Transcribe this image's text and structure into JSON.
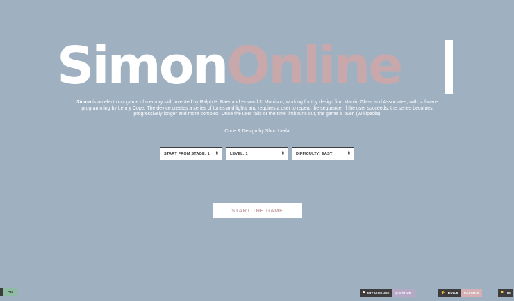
{
  "logo": {
    "word1": "Simon",
    "word2": "Online"
  },
  "description": {
    "lead": "Simon",
    "body": " is an electronic game of memory skill invented by Ralph H. Baer and Howard J. Morrison, working for toy design firm Marvin Glass and Associates, with software programming by Lenny Cope. The device creates a series of tones and lights and requires a user to repeat the sequence. If the user succeeds, the series becomes progressively longer and more complex. Once the user fails or the time limit runs out, the game is over. (Wikipedia)"
  },
  "credit": "Code & Design by Shun Ueda",
  "selects": {
    "stage": "START FROM STAGE: 1",
    "level": "LEVEL: 1",
    "difficulty": "DIFFICULTY: EASY"
  },
  "start_button": "START THE GAME",
  "badges": {
    "left_toggle": "ON",
    "license_label": "MIT LICENSE",
    "license_value": "@GITHUB",
    "build_label": "BUILD",
    "build_value": "PASSING",
    "cut_label": "HO"
  },
  "colors": {
    "background": "#9fb0c1",
    "accent": "#c9a8ab"
  }
}
